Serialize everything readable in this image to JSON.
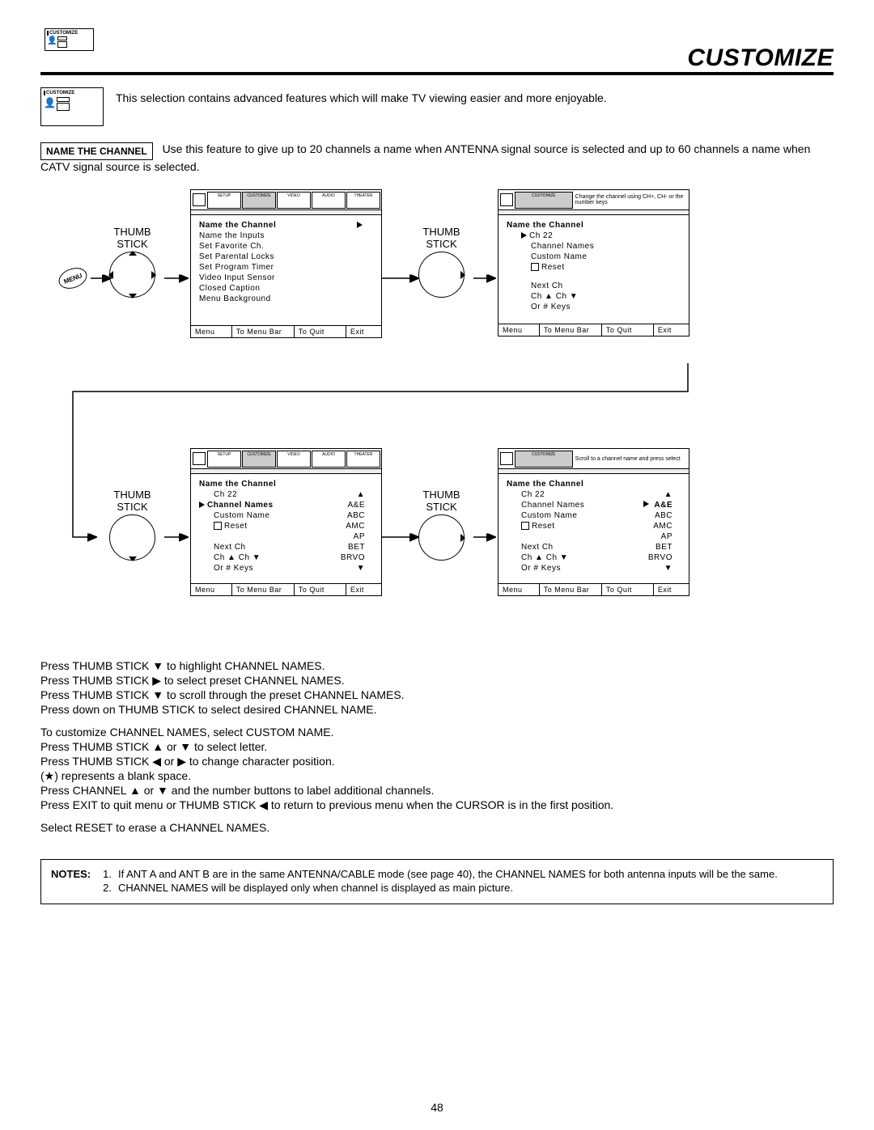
{
  "top_icon_label": "CUSTOMIZE",
  "title": "CUSTOMIZE",
  "intro": "This selection contains advanced features which will make TV viewing easier and more enjoyable.",
  "section_label": "NAME THE CHANNEL",
  "section_text": "Use this feature to give up to 20 channels a name when ANTENNA signal source is selected and up to 60 channels a name when CATV signal source is selected.",
  "thumb_label": "THUMB\nSTICK",
  "menu_btn": "MENU",
  "tabs": [
    "SETUP",
    "CUSTOMIZE",
    "VIDEO",
    "AUDIO",
    "THEATER"
  ],
  "hint1": "Change the channel using CH+, CH- or the number keys",
  "hint2": "Scroll to a channel name and press select",
  "screen1": {
    "heading": "Name the Channel",
    "items": [
      "Name the Inputs",
      "Set Favorite Ch.",
      "Set Parental Locks",
      "Set Program Timer",
      "Video Input Sensor",
      "Closed Caption",
      "Menu Background"
    ]
  },
  "screen2": {
    "heading": "Name the Channel",
    "ch": "Ch 22",
    "items": [
      "Channel Names",
      "Custom Name",
      "Reset"
    ],
    "next": "Next Ch",
    "nav": "Ch ▲ Ch ▼",
    "nav2": "Or # Keys"
  },
  "screen3": {
    "heading": "Name the Channel",
    "ch": "Ch 22",
    "sel": "Channel Names",
    "items": [
      "Custom Name",
      "Reset"
    ],
    "names": [
      "A&E",
      "ABC",
      "AMC",
      "AP",
      "BET",
      "BRVO"
    ],
    "next": "Next Ch",
    "nav": "Ch ▲ Ch ▼",
    "nav2": "Or # Keys"
  },
  "screen4": {
    "heading": "Name the Channel",
    "ch": "Ch 22",
    "items": [
      "Channel Names",
      "Custom Name",
      "Reset"
    ],
    "sel_name": "A&E",
    "names": [
      "A&E",
      "ABC",
      "AMC",
      "AP",
      "BET",
      "BRVO"
    ],
    "next": "Next Ch",
    "nav": "Ch ▲ Ch ▼",
    "nav2": "Or # Keys"
  },
  "footer": {
    "menu": "Menu",
    "bar": "To Menu Bar",
    "quit": "To Quit",
    "exit": "Exit"
  },
  "instructions": [
    "Press THUMB STICK  ▼ to highlight CHANNEL NAMES.",
    "Press THUMB STICK ▶ to select preset CHANNEL NAMES.",
    "Press THUMB STICK ▼ to scroll through the preset CHANNEL NAMES.",
    "Press down on THUMB STICK to select desired CHANNEL NAME."
  ],
  "instructions2": [
    "To customize CHANNEL NAMES, select CUSTOM NAME.",
    "Press THUMB STICK ▲ or ▼ to select letter.",
    "Press THUMB STICK ◀ or ▶ to change character position.",
    "(★) represents a blank space.",
    "Press CHANNEL ▲ or ▼  and the number buttons to label additional channels.",
    "Press EXIT to quit menu or THUMB STICK ◀ to return to previous menu when the CURSOR is in the first position."
  ],
  "instructions3": "Select RESET to erase a CHANNEL NAMES.",
  "notes_label": "NOTES:",
  "notes": [
    {
      "n": "1.",
      "t": "If ANT A and ANT B are in the same ANTENNA/CABLE mode (see page 40), the CHANNEL NAMES for both antenna inputs will be the same."
    },
    {
      "n": "2.",
      "t": "CHANNEL NAMES will be displayed only when channel is displayed as main picture."
    }
  ],
  "page_number": "48"
}
